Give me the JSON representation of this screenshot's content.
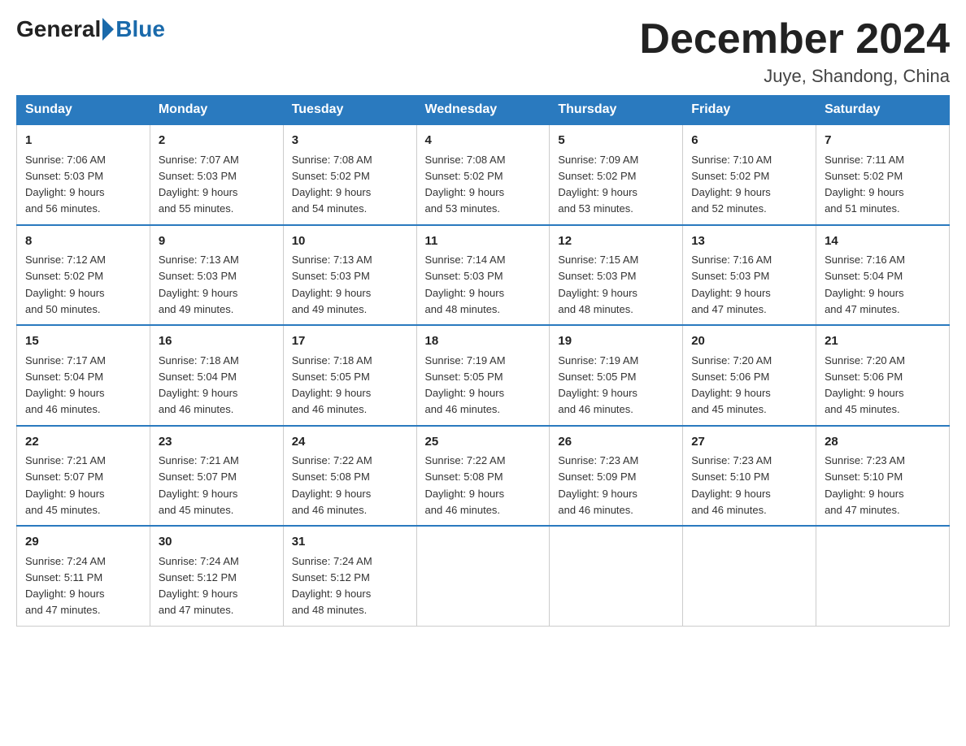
{
  "header": {
    "logo_general": "General",
    "logo_blue": "Blue",
    "month_title": "December 2024",
    "location": "Juye, Shandong, China"
  },
  "days_of_week": [
    "Sunday",
    "Monday",
    "Tuesday",
    "Wednesday",
    "Thursday",
    "Friday",
    "Saturday"
  ],
  "weeks": [
    [
      {
        "day": "1",
        "sunrise": "7:06 AM",
        "sunset": "5:03 PM",
        "daylight": "9 hours and 56 minutes."
      },
      {
        "day": "2",
        "sunrise": "7:07 AM",
        "sunset": "5:03 PM",
        "daylight": "9 hours and 55 minutes."
      },
      {
        "day": "3",
        "sunrise": "7:08 AM",
        "sunset": "5:02 PM",
        "daylight": "9 hours and 54 minutes."
      },
      {
        "day": "4",
        "sunrise": "7:08 AM",
        "sunset": "5:02 PM",
        "daylight": "9 hours and 53 minutes."
      },
      {
        "day": "5",
        "sunrise": "7:09 AM",
        "sunset": "5:02 PM",
        "daylight": "9 hours and 53 minutes."
      },
      {
        "day": "6",
        "sunrise": "7:10 AM",
        "sunset": "5:02 PM",
        "daylight": "9 hours and 52 minutes."
      },
      {
        "day": "7",
        "sunrise": "7:11 AM",
        "sunset": "5:02 PM",
        "daylight": "9 hours and 51 minutes."
      }
    ],
    [
      {
        "day": "8",
        "sunrise": "7:12 AM",
        "sunset": "5:02 PM",
        "daylight": "9 hours and 50 minutes."
      },
      {
        "day": "9",
        "sunrise": "7:13 AM",
        "sunset": "5:03 PM",
        "daylight": "9 hours and 49 minutes."
      },
      {
        "day": "10",
        "sunrise": "7:13 AM",
        "sunset": "5:03 PM",
        "daylight": "9 hours and 49 minutes."
      },
      {
        "day": "11",
        "sunrise": "7:14 AM",
        "sunset": "5:03 PM",
        "daylight": "9 hours and 48 minutes."
      },
      {
        "day": "12",
        "sunrise": "7:15 AM",
        "sunset": "5:03 PM",
        "daylight": "9 hours and 48 minutes."
      },
      {
        "day": "13",
        "sunrise": "7:16 AM",
        "sunset": "5:03 PM",
        "daylight": "9 hours and 47 minutes."
      },
      {
        "day": "14",
        "sunrise": "7:16 AM",
        "sunset": "5:04 PM",
        "daylight": "9 hours and 47 minutes."
      }
    ],
    [
      {
        "day": "15",
        "sunrise": "7:17 AM",
        "sunset": "5:04 PM",
        "daylight": "9 hours and 46 minutes."
      },
      {
        "day": "16",
        "sunrise": "7:18 AM",
        "sunset": "5:04 PM",
        "daylight": "9 hours and 46 minutes."
      },
      {
        "day": "17",
        "sunrise": "7:18 AM",
        "sunset": "5:05 PM",
        "daylight": "9 hours and 46 minutes."
      },
      {
        "day": "18",
        "sunrise": "7:19 AM",
        "sunset": "5:05 PM",
        "daylight": "9 hours and 46 minutes."
      },
      {
        "day": "19",
        "sunrise": "7:19 AM",
        "sunset": "5:05 PM",
        "daylight": "9 hours and 46 minutes."
      },
      {
        "day": "20",
        "sunrise": "7:20 AM",
        "sunset": "5:06 PM",
        "daylight": "9 hours and 45 minutes."
      },
      {
        "day": "21",
        "sunrise": "7:20 AM",
        "sunset": "5:06 PM",
        "daylight": "9 hours and 45 minutes."
      }
    ],
    [
      {
        "day": "22",
        "sunrise": "7:21 AM",
        "sunset": "5:07 PM",
        "daylight": "9 hours and 45 minutes."
      },
      {
        "day": "23",
        "sunrise": "7:21 AM",
        "sunset": "5:07 PM",
        "daylight": "9 hours and 45 minutes."
      },
      {
        "day": "24",
        "sunrise": "7:22 AM",
        "sunset": "5:08 PM",
        "daylight": "9 hours and 46 minutes."
      },
      {
        "day": "25",
        "sunrise": "7:22 AM",
        "sunset": "5:08 PM",
        "daylight": "9 hours and 46 minutes."
      },
      {
        "day": "26",
        "sunrise": "7:23 AM",
        "sunset": "5:09 PM",
        "daylight": "9 hours and 46 minutes."
      },
      {
        "day": "27",
        "sunrise": "7:23 AM",
        "sunset": "5:10 PM",
        "daylight": "9 hours and 46 minutes."
      },
      {
        "day": "28",
        "sunrise": "7:23 AM",
        "sunset": "5:10 PM",
        "daylight": "9 hours and 47 minutes."
      }
    ],
    [
      {
        "day": "29",
        "sunrise": "7:24 AM",
        "sunset": "5:11 PM",
        "daylight": "9 hours and 47 minutes."
      },
      {
        "day": "30",
        "sunrise": "7:24 AM",
        "sunset": "5:12 PM",
        "daylight": "9 hours and 47 minutes."
      },
      {
        "day": "31",
        "sunrise": "7:24 AM",
        "sunset": "5:12 PM",
        "daylight": "9 hours and 48 minutes."
      },
      null,
      null,
      null,
      null
    ]
  ],
  "labels": {
    "sunrise_prefix": "Sunrise: ",
    "sunset_prefix": "Sunset: ",
    "daylight_prefix": "Daylight: "
  }
}
